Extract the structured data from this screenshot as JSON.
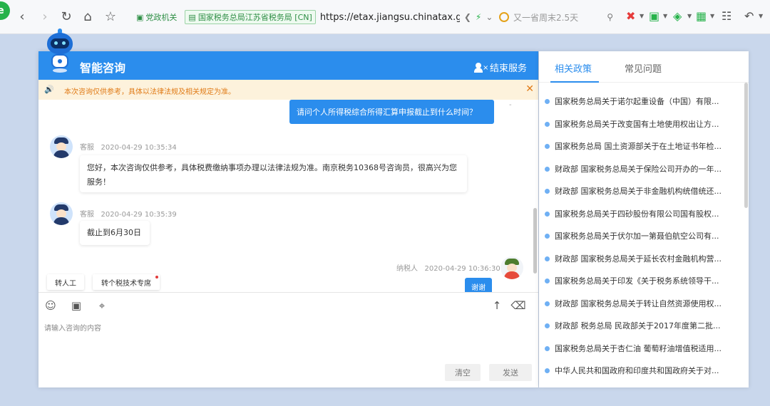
{
  "browser": {
    "chip1": "党政机关",
    "chip2": "国家税务总局江苏省税务局 [CN]",
    "url": "https://etax.jiangsu.chinatax.gov.cn",
    "search_text": "又一省周末2.5天"
  },
  "chat": {
    "title": "智能咨询",
    "end_service": "结束服务",
    "notice": "本次咨询仅供参考，具体以法律法规及相关规定为准。",
    "user_question": "请问个人所得税综合所得汇算申报截止到什么时间？",
    "messages": [
      {
        "sender": "客服",
        "time": "2020-04-29 10:35:34",
        "text": "您好，本次咨询仅供参考，具体税费缴纳事项办理以法律法规为准。南京税务10368号咨询员，很高兴为您服务！"
      },
      {
        "sender": "客服",
        "time": "2020-04-29 10:35:39",
        "text": "截止到6月30日"
      },
      {
        "sender": "纳税人",
        "time": "2020-04-29 10:36:30",
        "text": "谢谢"
      }
    ],
    "quick_buttons": [
      "转人工",
      "转个税技术专席"
    ],
    "input_placeholder": "请输入咨询的内容",
    "clear_label": "清空",
    "send_label": "发送"
  },
  "panel": {
    "tabs": [
      "相关政策",
      "常见问题"
    ],
    "items": [
      "国家税务总局关于诺尔起重设备（中国）有限...",
      "国家税务总局关于改变国有土地使用权出让方...",
      "国家税务总局 国土资源部关于在土地证书年检...",
      "财政部 国家税务总局关于保险公司开办的一年...",
      "财政部 国家税务总局关于非金融机构统借统还...",
      "国家税务总局关于四砂股份有限公司国有股权...",
      "国家税务总局关于伏尔加一第聂伯航空公司有...",
      "财政部 国家税务总局关于延长农村金融机构营...",
      "国家税务总局关于印发《关于税务系统领导干...",
      "财政部 国家税务总局关于转让自然资源使用权...",
      "财政部 税务总局 民政部关于2017年度第二批...",
      "国家税务总局关于杏仁油 葡萄籽油增值税适用...",
      "中华人民共和国政府和印度共和国政府关于对..."
    ]
  },
  "colors": {
    "accent": "#2b8ded",
    "notice_bg": "#fdf2dc",
    "notice_text": "#e07b17"
  }
}
